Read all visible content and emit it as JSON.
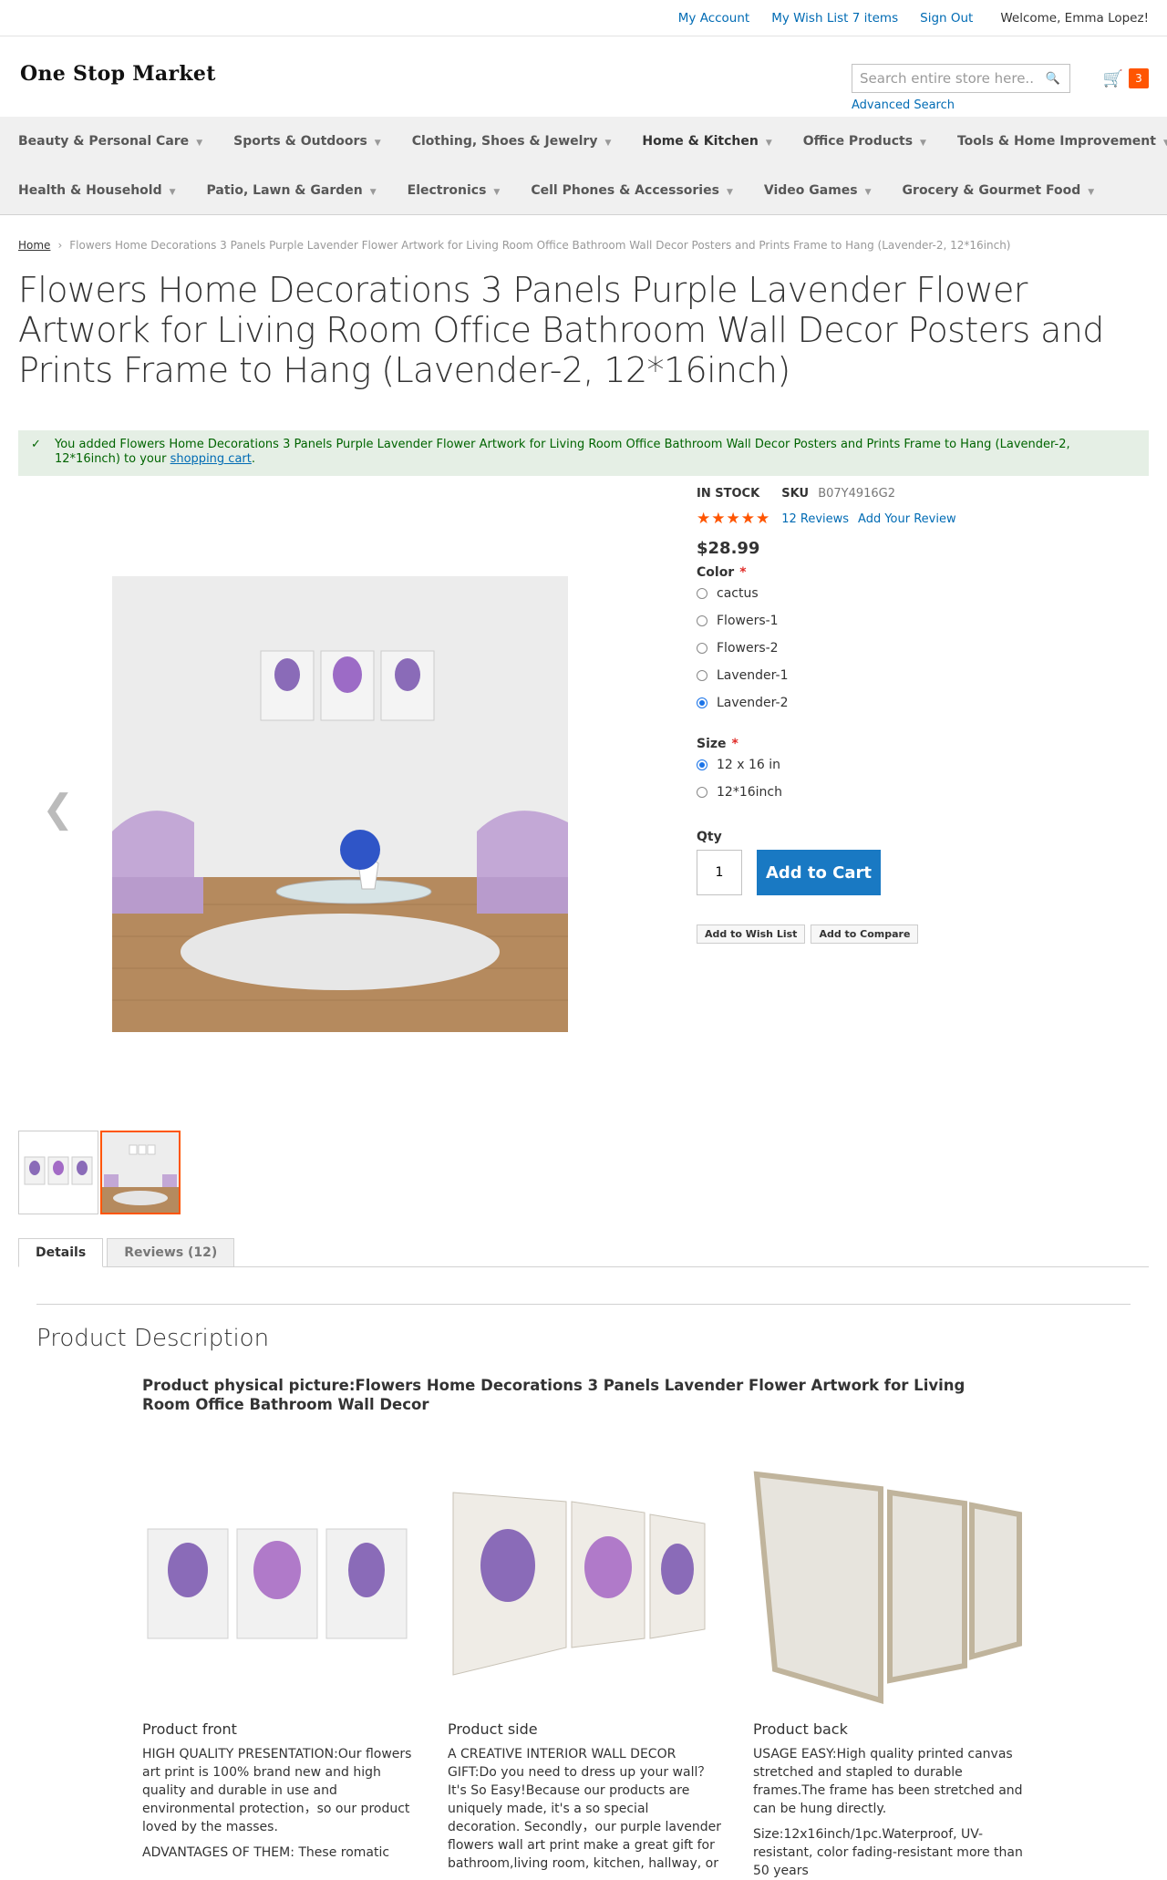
{
  "header": {
    "my_account": "My Account",
    "wish_list": "My Wish List 7 items",
    "sign_out": "Sign Out",
    "welcome": "Welcome, Emma Lopez!"
  },
  "logo": "One Stop Market",
  "search": {
    "placeholder": "Search entire store here...",
    "advanced": "Advanced Search"
  },
  "cart": {
    "count": "3"
  },
  "nav": {
    "row1": [
      "Beauty & Personal Care",
      "Sports & Outdoors",
      "Clothing, Shoes & Jewelry",
      "Home & Kitchen",
      "Office Products",
      "Tools & Home Improvement"
    ],
    "row2": [
      "Health & Household",
      "Patio, Lawn & Garden",
      "Electronics",
      "Cell Phones & Accessories",
      "Video Games",
      "Grocery & Gourmet Food"
    ]
  },
  "breadcrumb": {
    "home": "Home",
    "current": "Flowers Home Decorations 3 Panels Purple Lavender Flower Artwork for Living Room Office Bathroom Wall Decor Posters and Prints Frame to Hang (Lavender-2, 12*16inch)"
  },
  "product": {
    "title": "Flowers Home Decorations 3 Panels Purple Lavender Flower Artwork for Living Room Office Bathroom Wall Decor Posters and Prints Frame to Hang (Lavender-2, 12*16inch)",
    "message_prefix": "You added Flowers Home Decorations 3 Panels Purple Lavender Flower Artwork for Living Room Office Bathroom Wall Decor Posters and Prints Frame to Hang (Lavender-2, 12*16inch) to your",
    "message_link": "shopping cart",
    "message_suffix": ".",
    "stock": "In stock",
    "sku_label": "SKU",
    "sku": "B07Y4916G2",
    "reviews_link": "12  Reviews",
    "add_review": "Add Your Review",
    "rating_stars": 5,
    "price": "$28.99",
    "color_label": "Color",
    "colors": [
      "cactus",
      "Flowers-1",
      "Flowers-2",
      "Lavender-1",
      "Lavender-2"
    ],
    "color_selected": "Lavender-2",
    "size_label": "Size",
    "sizes": [
      "12 x 16 in",
      "12*16inch"
    ],
    "size_selected": "12 x 16 in",
    "qty_label": "Qty",
    "qty": "1",
    "add_to_cart": "Add to Cart",
    "add_to_wishlist": "Add to Wish List",
    "add_to_compare": "Add to Compare"
  },
  "tabs": [
    "Details",
    "Reviews (12)"
  ],
  "description": {
    "heading": "Product Description",
    "subtitle": "Product physical picture:Flowers Home Decorations 3 Panels Lavender Flower Artwork for Living Room Office Bathroom Wall Decor",
    "columns": [
      {
        "caption": "Product front",
        "p1": "HIGH QUALITY PRESENTATION:Our flowers art print is 100% brand new and high quality and durable in use and environmental protection，so our product loved by the masses.",
        "p2": "ADVANTAGES OF THEM: These romatic"
      },
      {
        "caption": "Product side",
        "p1": "A CREATIVE INTERIOR WALL DECOR GIFT:Do you need to dress up your wall？It's So Easy!Because our products are uniquely made, it's a so special decoration. Secondly，our purple lavender flowers wall art print make a great gift for bathroom,living room, kitchen, hallway, or",
        "p2": ""
      },
      {
        "caption": "Product back",
        "p1": "USAGE EASY:High quality printed canvas stretched and stapled to durable frames.The frame has been stretched and can be hung directly.",
        "p2": "Size:12x16inch/1pc.Waterproof, UV-resistant, color fading-resistant more than 50 years"
      }
    ]
  },
  "colors": {
    "accent": "#1979c3",
    "cart_badge": "#ff5501",
    "stars": "#ff5501",
    "success_bg": "#e5efe5"
  }
}
